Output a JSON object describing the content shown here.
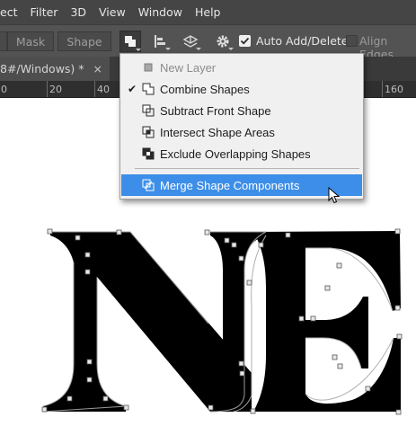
{
  "menubar": {
    "items": [
      "ect",
      "Filter",
      "3D",
      "View",
      "Window",
      "Help"
    ]
  },
  "options_bar": {
    "mask_label": "Mask",
    "shape_label": "Shape",
    "auto_add_delete_label": "Auto Add/Delete",
    "auto_add_delete_checked": true,
    "align_edges_label": "Align Edges",
    "align_edges_checked": false
  },
  "document_tab": {
    "title": "8#/Windows) *",
    "close": "×"
  },
  "ruler": {
    "ticks": [
      "0",
      "20",
      "40",
      "160"
    ]
  },
  "path_operations_menu": {
    "items": [
      {
        "label": "New Layer",
        "icon": "new-layer-icon",
        "checked": false,
        "disabled": true,
        "highlighted": false
      },
      {
        "label": "Combine Shapes",
        "icon": "combine-shapes-icon",
        "checked": true,
        "disabled": false,
        "highlighted": false
      },
      {
        "label": "Subtract Front Shape",
        "icon": "subtract-front-shape-icon",
        "checked": false,
        "disabled": false,
        "highlighted": false
      },
      {
        "label": "Intersect Shape Areas",
        "icon": "intersect-shape-areas-icon",
        "checked": false,
        "disabled": false,
        "highlighted": false
      },
      {
        "label": "Exclude Overlapping Shapes",
        "icon": "exclude-overlapping-shapes-icon",
        "checked": false,
        "disabled": false,
        "highlighted": false
      },
      {
        "label": "Merge Shape Components",
        "icon": "merge-shape-components-icon",
        "checked": false,
        "disabled": false,
        "highlighted": true
      }
    ],
    "check_glyph": "✔"
  },
  "canvas": {
    "artwork": "NE letter shapes with path anchor points"
  },
  "colors": {
    "menubar_bg": "#454545",
    "optionsbar_bg": "#535353",
    "highlight": "#3d8ee8",
    "dropdown_bg": "#f0f0f0"
  }
}
